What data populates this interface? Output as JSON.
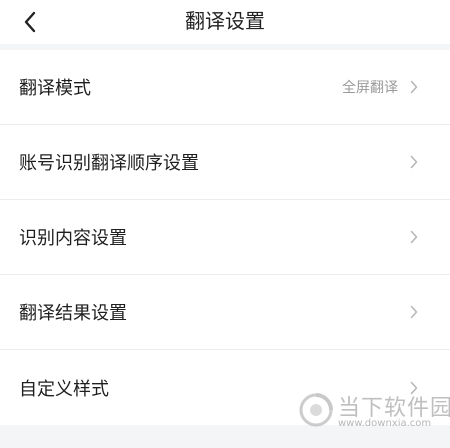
{
  "header": {
    "title": "翻译设置",
    "back_icon": "chevron-left-icon"
  },
  "list": {
    "items": [
      {
        "label": "翻译模式",
        "value": "全屏翻译"
      },
      {
        "label": "账号识别翻译顺序设置",
        "value": ""
      },
      {
        "label": "识别内容设置",
        "value": ""
      },
      {
        "label": "翻译结果设置",
        "value": ""
      },
      {
        "label": "自定义样式",
        "value": ""
      }
    ],
    "chevron_icon": "chevron-right-icon"
  },
  "watermark": {
    "name": "当下软件园",
    "url": "www.downxia.com"
  },
  "colors": {
    "background": "#f4f5f7",
    "surface": "#ffffff",
    "text": "#1f1f1f",
    "secondary_text": "#9a9a9a",
    "divider": "#ececec"
  }
}
